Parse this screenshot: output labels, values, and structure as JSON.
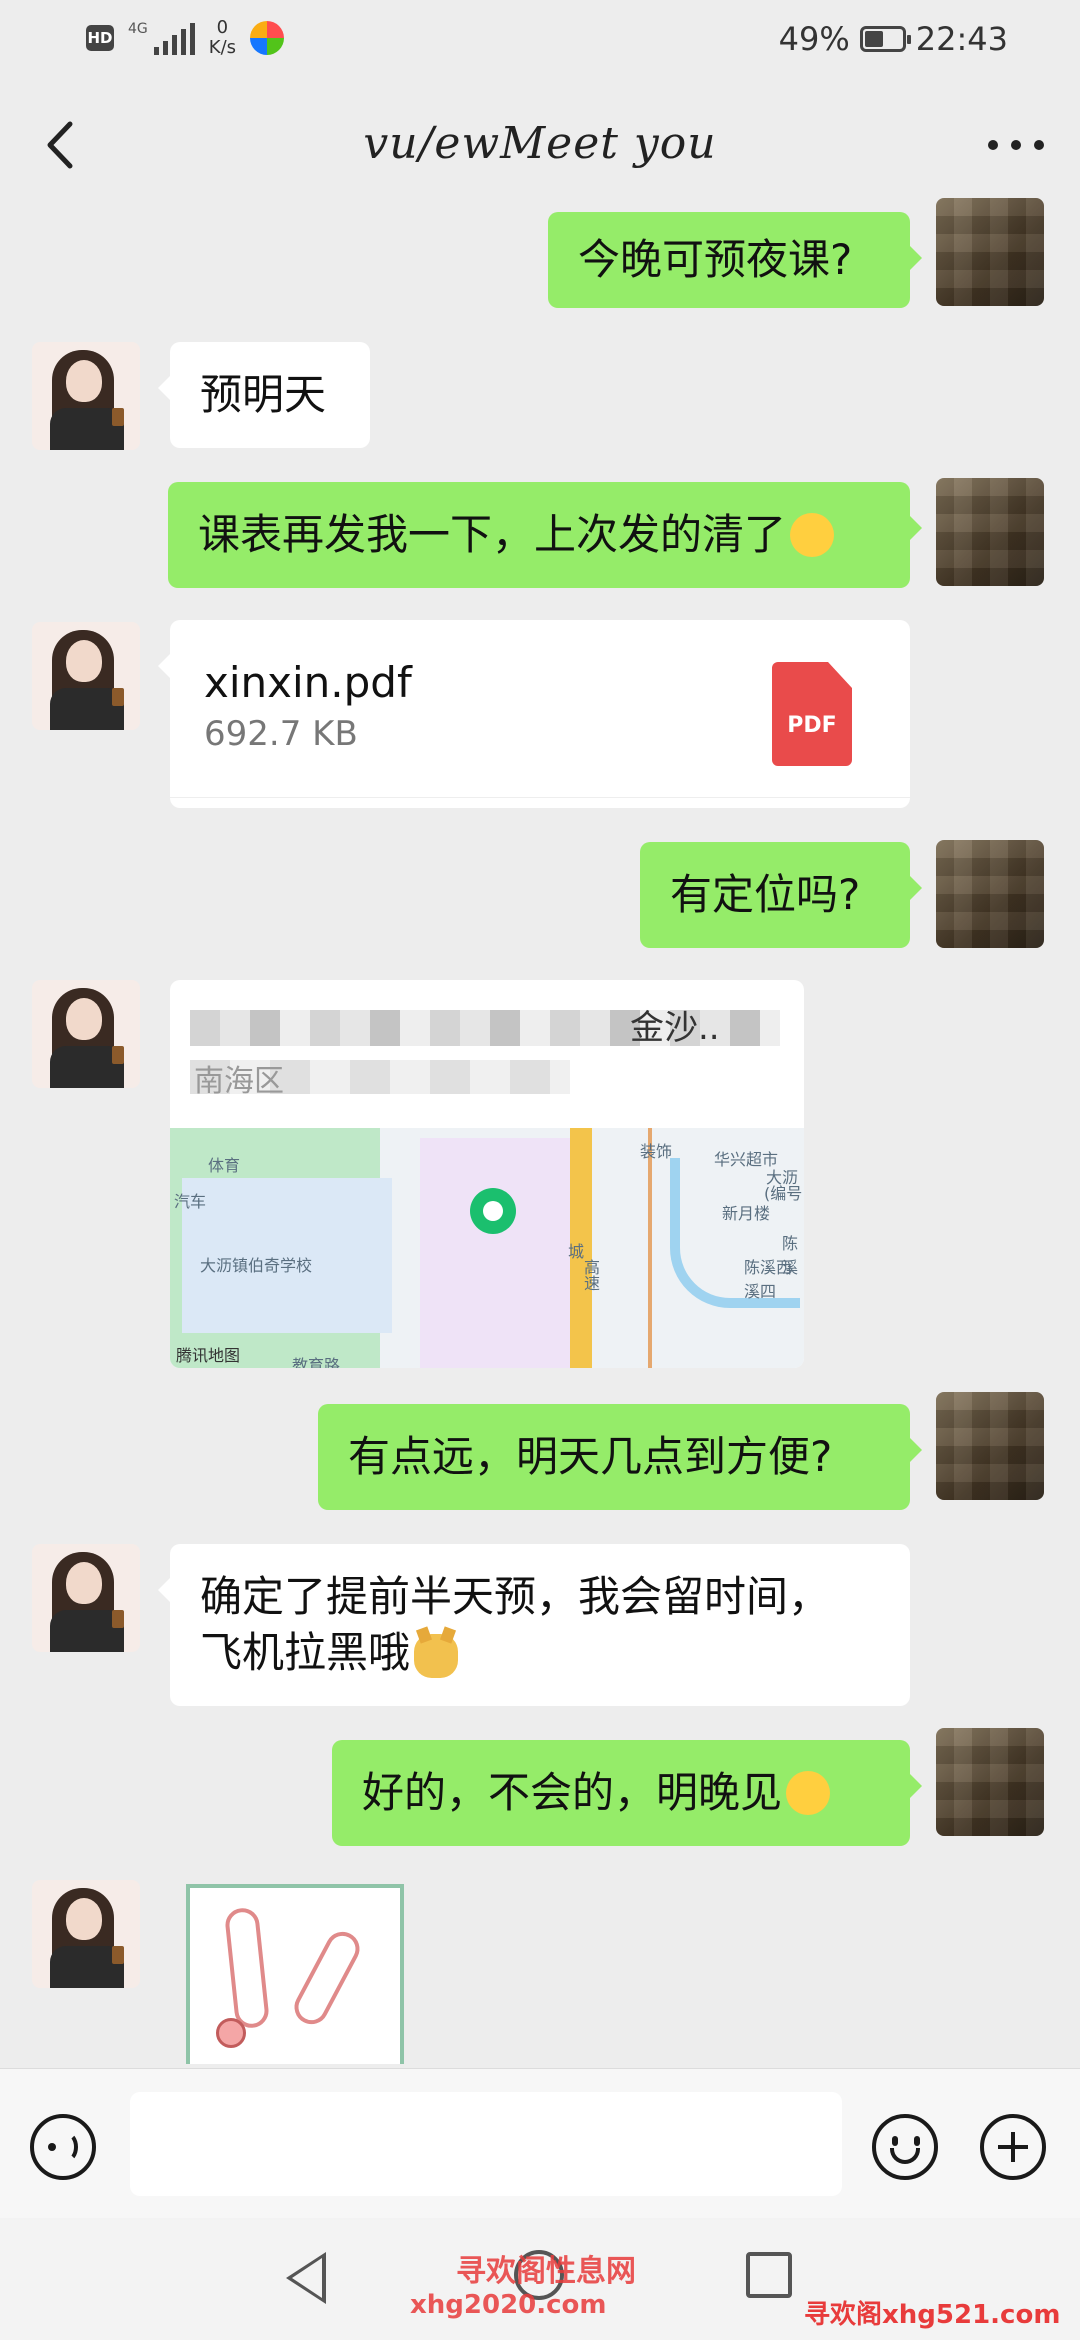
{
  "status_bar": {
    "hd_label": "HD",
    "network_type": "4G",
    "net_speed_value": "0",
    "net_speed_unit": "K/s",
    "battery_percent": "49%",
    "battery_level": 0.49,
    "time": "22:43"
  },
  "header": {
    "title": "vu/ewMeet you",
    "back_icon": "chevron-left-icon",
    "more_icon": "more-dots-icon"
  },
  "messages": [
    {
      "side": "out",
      "type": "text",
      "text": "今晚可预夜课?"
    },
    {
      "side": "in",
      "type": "text",
      "text": "预明天"
    },
    {
      "side": "out",
      "type": "text",
      "text": "课表再发我一下，上次发的清了",
      "emoji": "rofl-emoji"
    },
    {
      "side": "in",
      "type": "file",
      "file_name": "xinxin.pdf",
      "file_size": "692.7 KB",
      "file_icon": "pdf-icon",
      "file_icon_label": "PDF"
    },
    {
      "side": "out",
      "type": "text",
      "text": "有定位吗?"
    },
    {
      "side": "in",
      "type": "location",
      "title_tail": "金沙..",
      "subtitle": "南海区",
      "map_labels": [
        "体育",
        "汽车",
        "大沥镇伯奇学校",
        "城",
        "高",
        "速",
        "华兴超市",
        "大沥",
        "(编号",
        "新月楼",
        "陈溪",
        "陈溪西溪四",
        "装饰",
        "教育路"
      ],
      "map_provider": "腾讯地图"
    },
    {
      "side": "out",
      "type": "text",
      "text": "有点远，明天几点到方便?"
    },
    {
      "side": "in",
      "type": "text",
      "line1": "确定了提前半天预，我会留时间，",
      "line2": "飞机拉黑哦",
      "emoji": "doge-emoji"
    },
    {
      "side": "out",
      "type": "text",
      "text": "好的，不会的，明晚见",
      "emoji": "kiss-emoji"
    },
    {
      "side": "in",
      "type": "sticker",
      "sticker_icon": "rabbit-sticker-icon"
    }
  ],
  "input_bar": {
    "voice_icon": "voice-icon",
    "input_value": "",
    "emoji_icon": "smile-icon",
    "plus_icon": "plus-icon"
  },
  "nav_bar": {
    "back_icon": "nav-back-icon",
    "home_icon": "nav-home-icon",
    "recent_icon": "nav-recent-icon"
  },
  "watermarks": {
    "line1": "寻欢阁性息网",
    "line2": "xhg2020.com",
    "line3": "寻欢阁xhg521.com"
  }
}
